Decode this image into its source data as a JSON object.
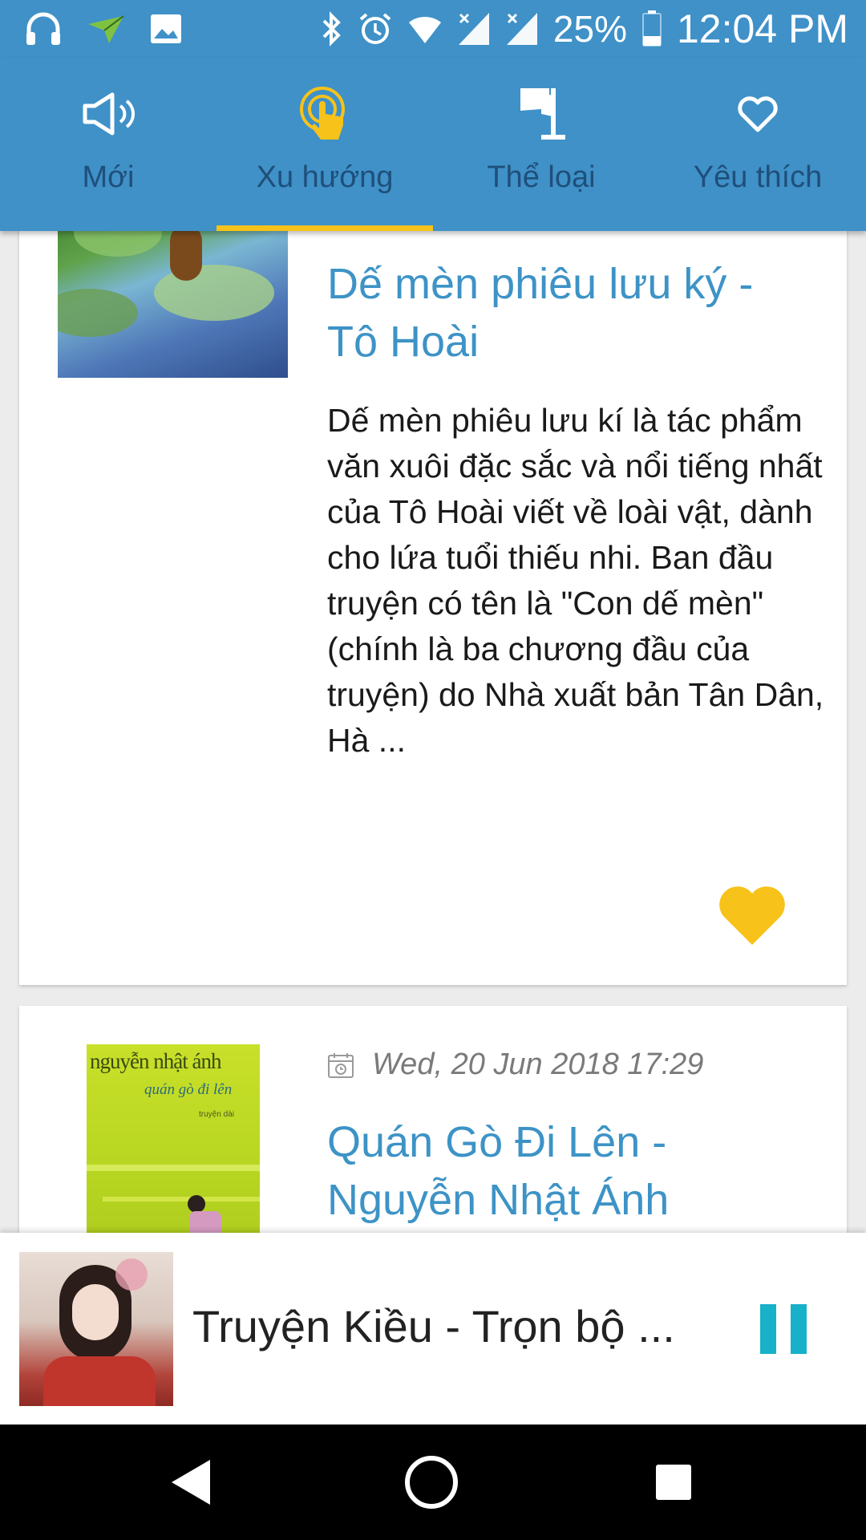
{
  "status_bar": {
    "battery": "25%",
    "time": "12:04 PM",
    "icons": [
      "headset-icon",
      "send-icon",
      "image-icon",
      "bluetooth-icon",
      "alarm-icon",
      "wifi-icon",
      "signal-icon",
      "signal-icon",
      "battery-icon"
    ]
  },
  "tabs": [
    {
      "label": "Mới",
      "icon": "megaphone-icon",
      "selected": false
    },
    {
      "label": "Xu hướng",
      "icon": "touch-icon",
      "selected": true
    },
    {
      "label": "Thể loại",
      "icon": "flag-icon",
      "selected": false
    },
    {
      "label": "Yêu thích",
      "icon": "heart-outline-icon",
      "selected": false
    }
  ],
  "colors": {
    "primary": "#3f91c8",
    "accent": "#f7c21a",
    "title": "#3d93c6"
  },
  "stories": [
    {
      "title": "Dế mèn phiêu lưu ký - Tô Hoài",
      "description": "Dế mèn phiêu lưu kí là tác phẩm văn xuôi đặc sắc và nổi tiếng nhất của Tô Hoài viết về loài vật, dành cho lứa tuổi thiếu nhi. Ban đầu truyện có tên là \"Con dế mèn\" (chính là ba chương đầu của truyện) do Nhà xuất bản Tân Dân, Hà ...",
      "favorited": true
    },
    {
      "date": "Wed, 20 Jun 2018 17:29",
      "title": "Quán Gò Đi Lên - Nguyễn Nhật Ánh",
      "cover_author": "nguyễn nhật ánh",
      "cover_title": "quán gò đi lên",
      "cover_small": "truyện dài"
    }
  ],
  "player": {
    "title": "Truyện Kiều - Trọn bộ ...",
    "state": "playing"
  }
}
